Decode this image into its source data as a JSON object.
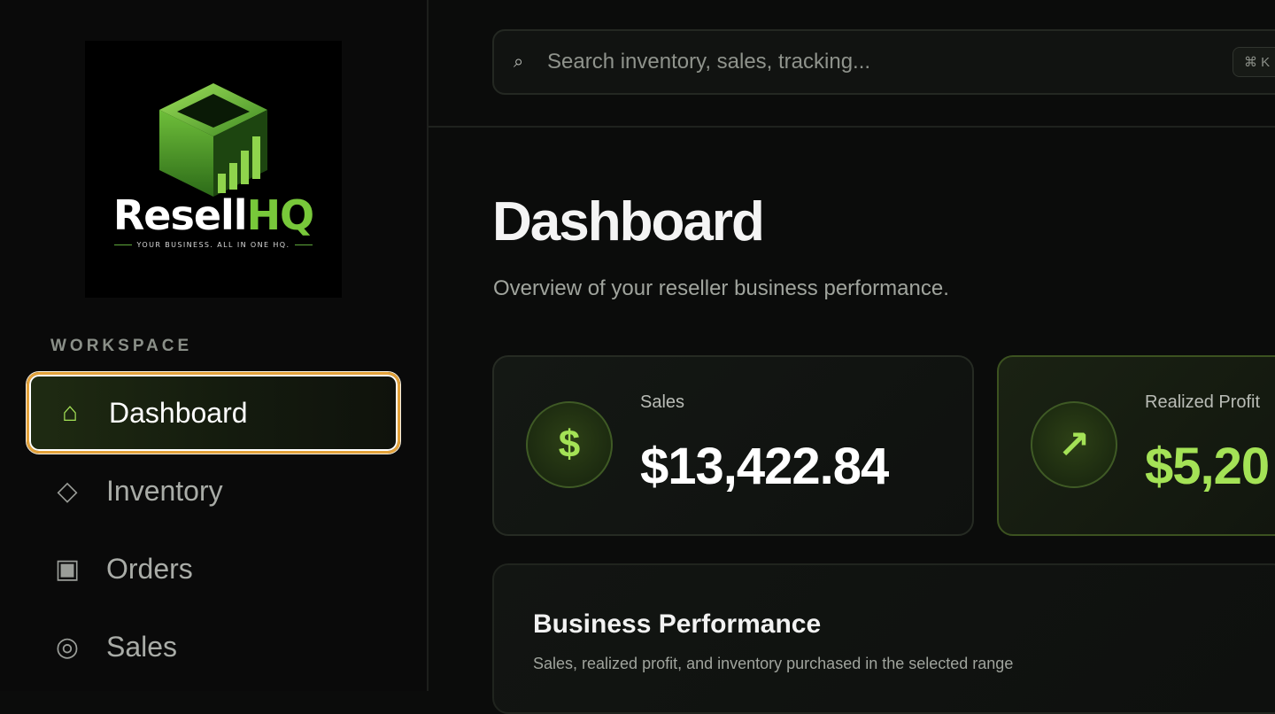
{
  "brand": {
    "name_main": "Resell",
    "name_accent": "HQ",
    "tagline": "YOUR BUSINESS. ALL IN ONE HQ.",
    "accent_color": "#a4e256"
  },
  "sidebar": {
    "section_label": "WORKSPACE",
    "items": [
      {
        "label": "Dashboard",
        "icon": "home-icon",
        "glyph": "⌂",
        "active": true
      },
      {
        "label": "Inventory",
        "icon": "diamond-icon",
        "glyph": "◇",
        "active": false
      },
      {
        "label": "Orders",
        "icon": "square-icon",
        "glyph": "▣",
        "active": false
      },
      {
        "label": "Sales",
        "icon": "circle-icon",
        "glyph": "◎",
        "active": false
      }
    ]
  },
  "search": {
    "placeholder": "Search inventory, sales, tracking...",
    "shortcut": "⌘ K",
    "icon": "search-icon"
  },
  "page": {
    "title": "Dashboard",
    "subtitle": "Overview of your reseller business performance."
  },
  "stats": [
    {
      "label": "Sales",
      "value": "$13,422.84",
      "icon": "dollar-icon",
      "glyph": "$"
    },
    {
      "label": "Realized Profit",
      "value": "$5,20",
      "icon": "arrow-up-right-icon",
      "glyph": "↗"
    }
  ],
  "performance": {
    "title": "Business Performance",
    "subtitle": "Sales, realized profit, and inventory purchased in the selected range"
  }
}
